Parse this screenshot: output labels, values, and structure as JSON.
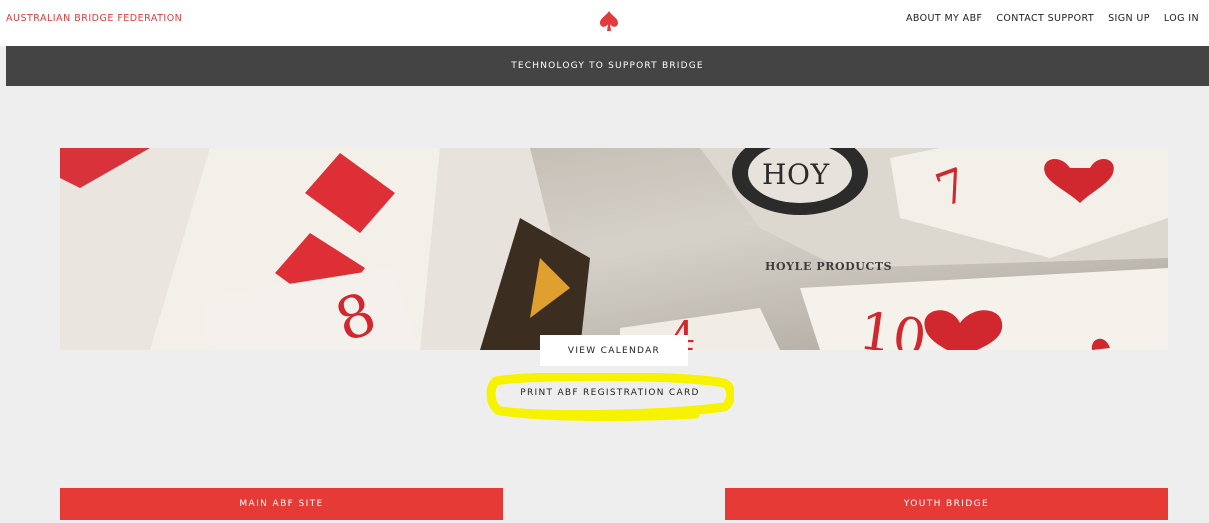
{
  "header": {
    "brand": "AUSTRALIAN BRIDGE FEDERATION",
    "logo_icon": "spade-icon",
    "nav": [
      "ABOUT MY ABF",
      "CONTACT SUPPORT",
      "SIGN UP",
      "LOG IN"
    ]
  },
  "banner": {
    "text": "TECHNOLOGY TO SUPPORT BRIDGE"
  },
  "hero": {
    "image": "playing-cards-photo"
  },
  "actions": {
    "view_calendar": "VIEW CALENDAR",
    "print_card": "PRINT ABF REGISTRATION CARD"
  },
  "links": {
    "main_site": "MAIN ABF SITE",
    "youth_bridge": "YOUTH BRIDGE"
  },
  "colors": {
    "accent": "#e53a35",
    "banner": "#444444",
    "background": "#eeeeee",
    "highlight": "#ffff00"
  }
}
